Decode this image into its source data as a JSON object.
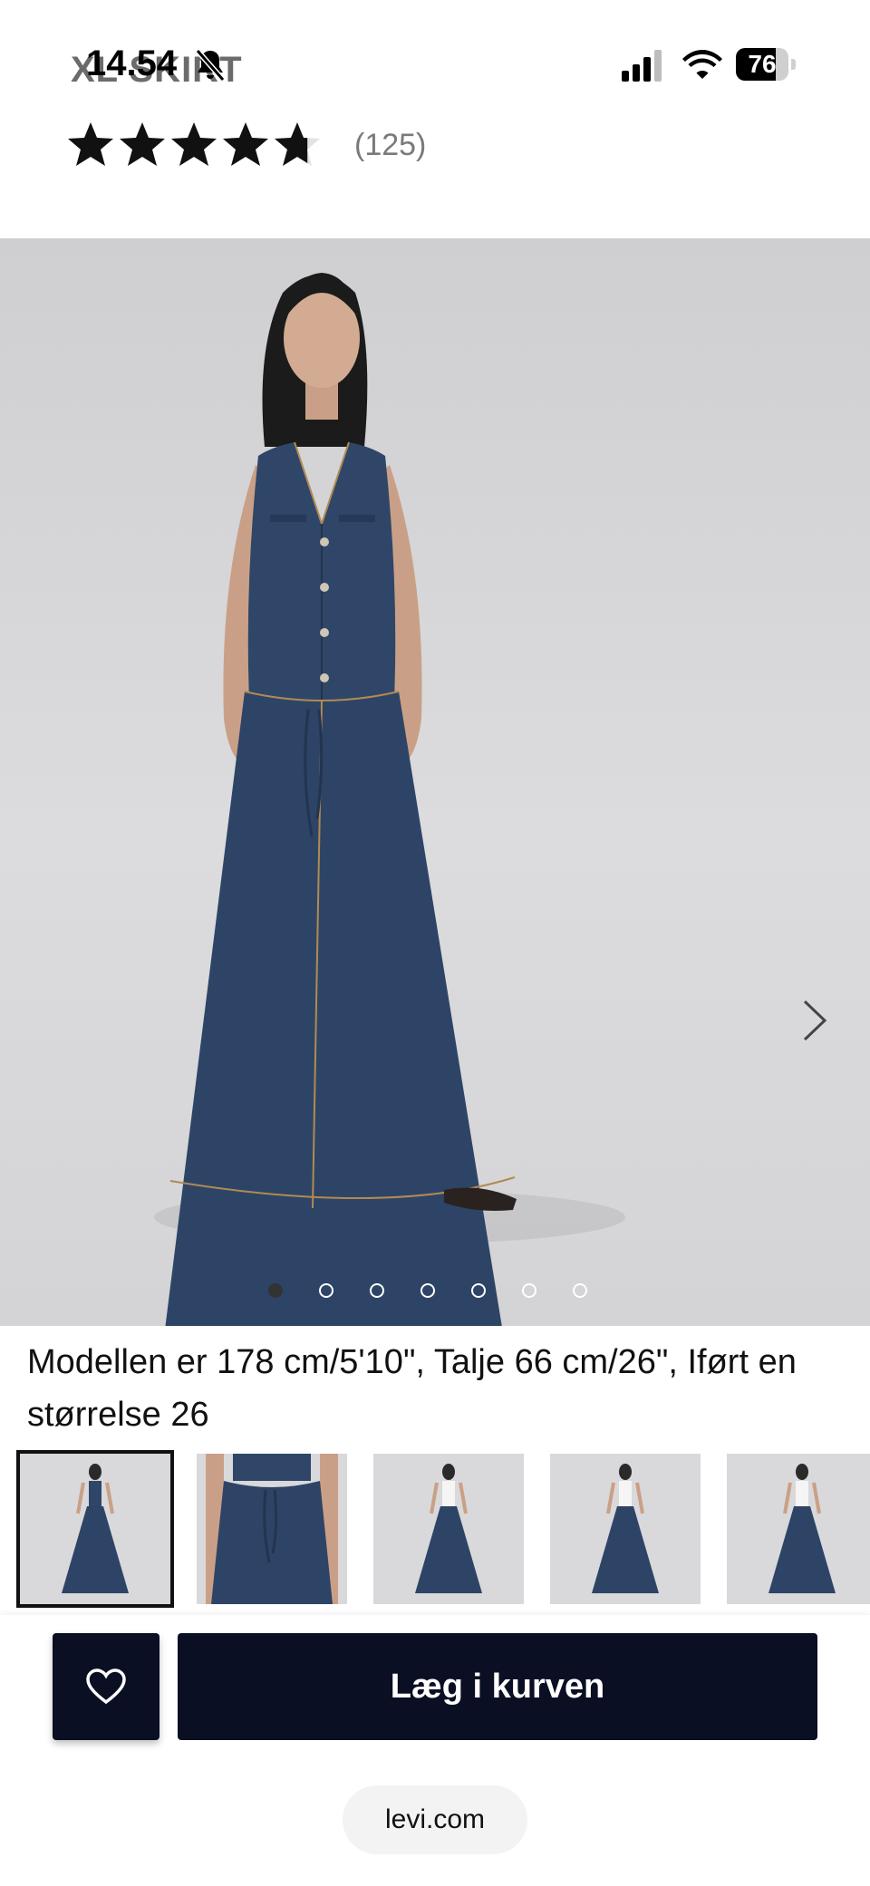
{
  "status_bar": {
    "time": "14.54",
    "battery": "76",
    "battery_level": 0.76,
    "icons": [
      "bell-muted-icon",
      "signal-icon",
      "wifi-icon",
      "battery-icon"
    ]
  },
  "header": {
    "behind_title": "XL SKIRT"
  },
  "rating": {
    "stars": 4.7,
    "count": "(125)"
  },
  "gallery": {
    "image_count": 7,
    "active_index": 0,
    "next_icon": "chevron-right-icon"
  },
  "caption": {
    "text": "Modellen er 178 cm/5'10\", Talje 66 cm/26\", Iført en størrelse 26"
  },
  "thumbnails": [
    {
      "view": "front-full",
      "selected": true
    },
    {
      "view": "detail-waist",
      "selected": false
    },
    {
      "view": "back-white-top",
      "selected": false
    },
    {
      "view": "side-white-top",
      "selected": false
    },
    {
      "view": "front-white-top",
      "selected": false
    }
  ],
  "actions": {
    "favorite_icon": "heart-icon",
    "add_to_cart": "Læg i kurven"
  },
  "browser": {
    "url": "levi.com"
  },
  "colors": {
    "button_bg": "#0b0f24",
    "denim": "#2e4466",
    "background": "#ffffff"
  }
}
